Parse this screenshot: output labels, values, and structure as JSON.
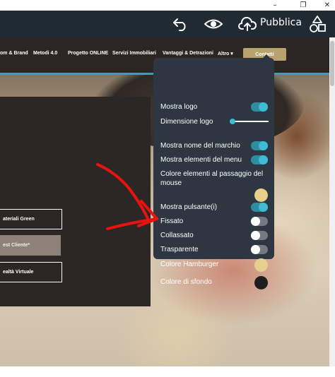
{
  "window_controls": [
    "–",
    "❐",
    "✕"
  ],
  "editor_toolbar": {
    "undo_icon": "undo-arrow-icon",
    "preview_icon": "eye-icon",
    "publish_icon": "cloud-upload-icon",
    "publish_label": "Pubblica",
    "elements_icon": "shapes-icon"
  },
  "site_nav": {
    "items": [
      "om & Brand",
      "Metodi 4.0",
      "Progetto ONLINE",
      "Servizi Immobiliari",
      "Vantaggi & Detrazioni",
      "Altro ▾"
    ],
    "cta": "Contatti",
    "accent_line_color": "#3aa0b8"
  },
  "hero": {
    "buttons": [
      "ateriali Green",
      "est Cliente*",
      "ealtà Virtuale"
    ]
  },
  "settings_popup": {
    "options": [
      {
        "label": "Mostra logo",
        "control": "toggle",
        "on": true
      },
      {
        "label": "Dimensione logo",
        "control": "slider",
        "value": 0.05
      },
      {
        "label": "Mostra nome del marchio",
        "control": "toggle",
        "on": true
      },
      {
        "label": "Mostra elementi del menu",
        "control": "toggle",
        "on": true
      },
      {
        "label": "Colore elementi al passaggio del mouse",
        "control": "color",
        "color": "#e8d08c"
      },
      {
        "label": "Mostra pulsante(i)",
        "control": "toggle",
        "on": true
      },
      {
        "label": "Fissato",
        "control": "toggle",
        "on": false
      },
      {
        "label": "Collassato",
        "control": "toggle",
        "on": false
      },
      {
        "label": "Trasparente",
        "control": "toggle",
        "on": false
      },
      {
        "label": "Colore Hamburger",
        "control": "color",
        "color": "#e6cf90"
      },
      {
        "label": "Colore di sfondo",
        "control": "color",
        "color": "#1e1e1e"
      }
    ]
  },
  "colors": {
    "toolbar_bg": "#1f2a33",
    "popup_bg": "#2e3642",
    "toggle_on": "#3fbcd3",
    "annotation_arrow": "#e8130f"
  }
}
